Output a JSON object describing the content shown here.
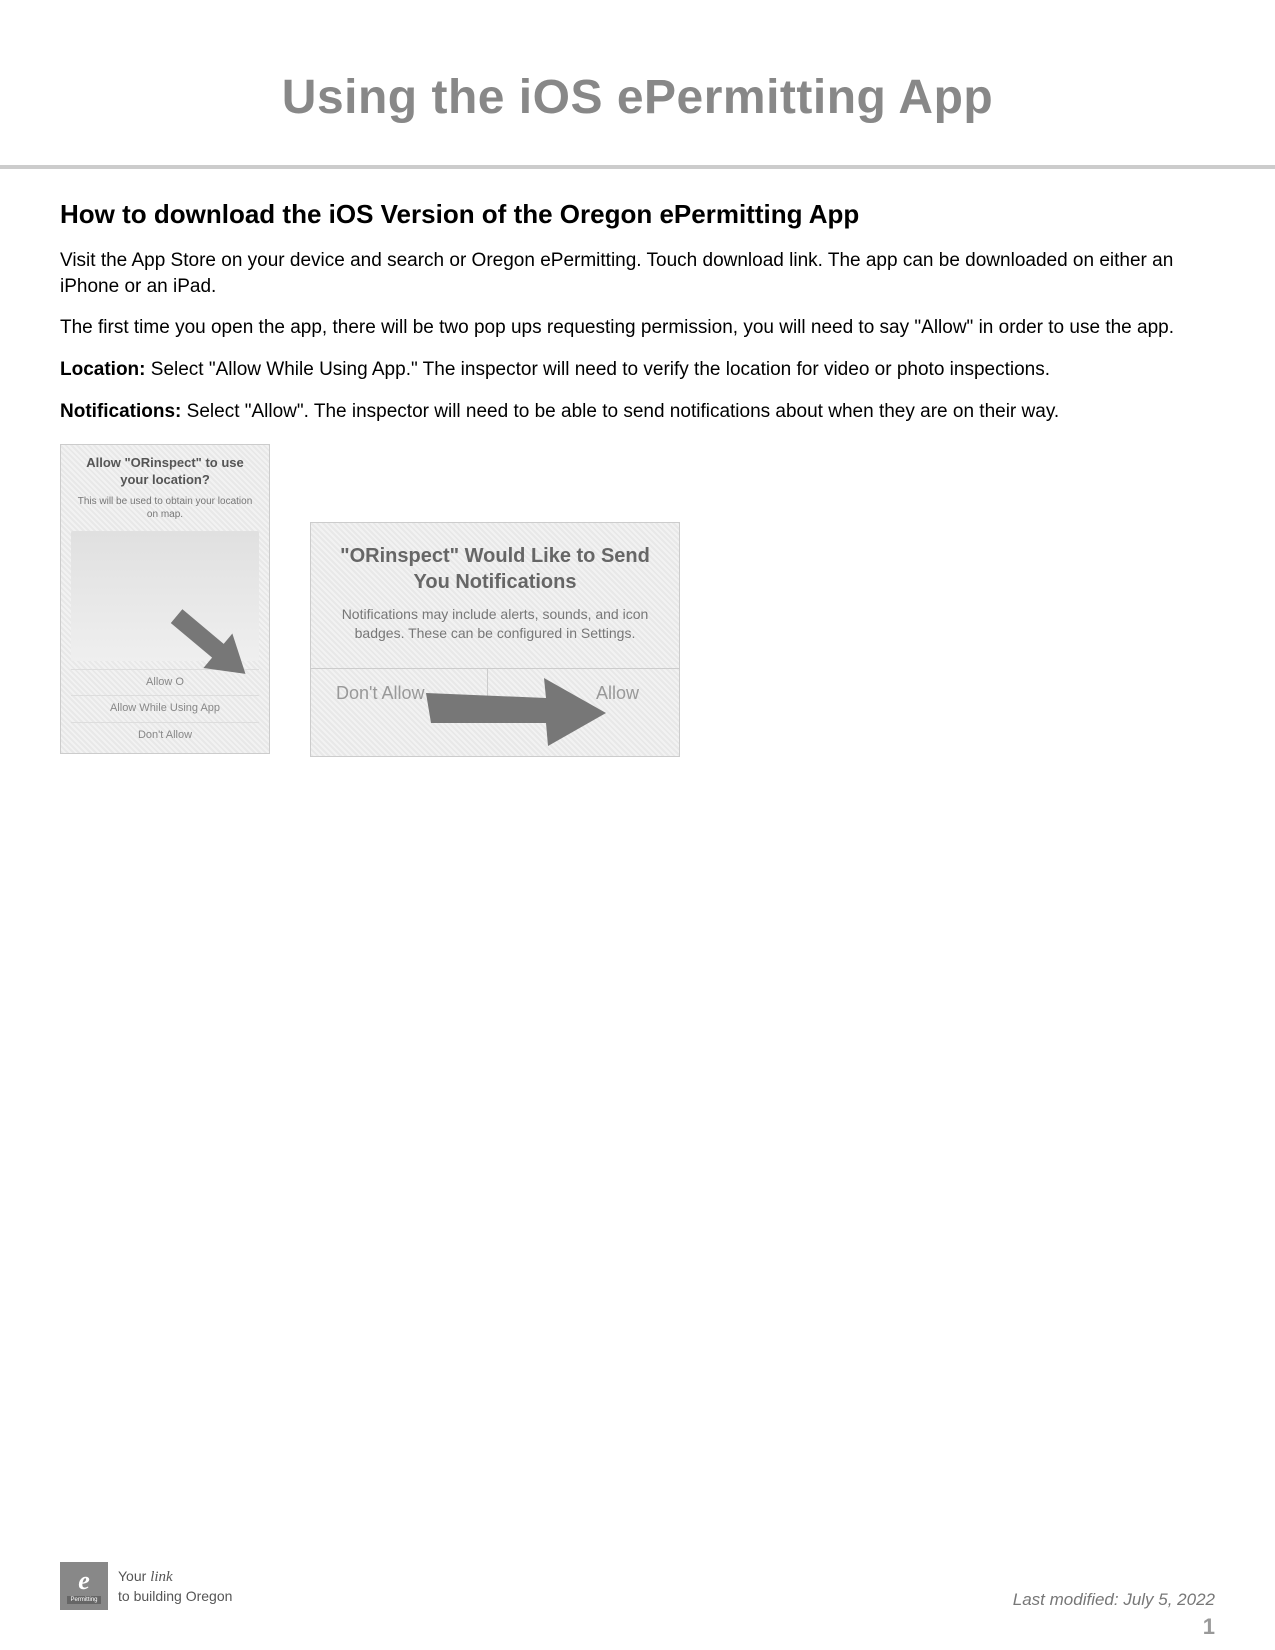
{
  "page": {
    "title": "Using the iOS ePermitting App",
    "section_heading": "How to download the iOS Version of the Oregon ePermitting App",
    "para1": "Visit the App Store on your device and search or Oregon ePermitting. Touch download link. The app can be downloaded on either an iPhone or an iPad.",
    "para2": "The first time you open the app, there will be two pop ups requesting permission, you will need to say \"Allow\" in order to use the app.",
    "location_label": "Location:",
    "location_text": " Select \"Allow While Using App.\" The inspector will need to verify the location for video or photo inspections.",
    "notifications_label": "Notifications:",
    "notifications_text": " Select \"Allow\". The inspector will need to be able to send notifications about when they are on their way."
  },
  "dialog1": {
    "title": "Allow \"ORinspect\" to use your location?",
    "sub": "This will be used to obtain your location on map.",
    "opt1": "Allow O",
    "opt2": "Allow While Using App",
    "opt3": "Don't Allow"
  },
  "dialog2": {
    "title": "\"ORinspect\" Would Like to Send You Notifications",
    "sub": "Notifications may include alerts, sounds, and icon badges. These can be configured in Settings.",
    "btn_left": "Don't Allow",
    "btn_right": "Allow"
  },
  "footer": {
    "link_line1_pre": "Your ",
    "link_line1_script": "link",
    "link_line2": "to building Oregon",
    "logo_e": "e",
    "logo_perm": "Permitting",
    "last_modified": "Last modified: July 5, 2022",
    "page_num": "1"
  }
}
